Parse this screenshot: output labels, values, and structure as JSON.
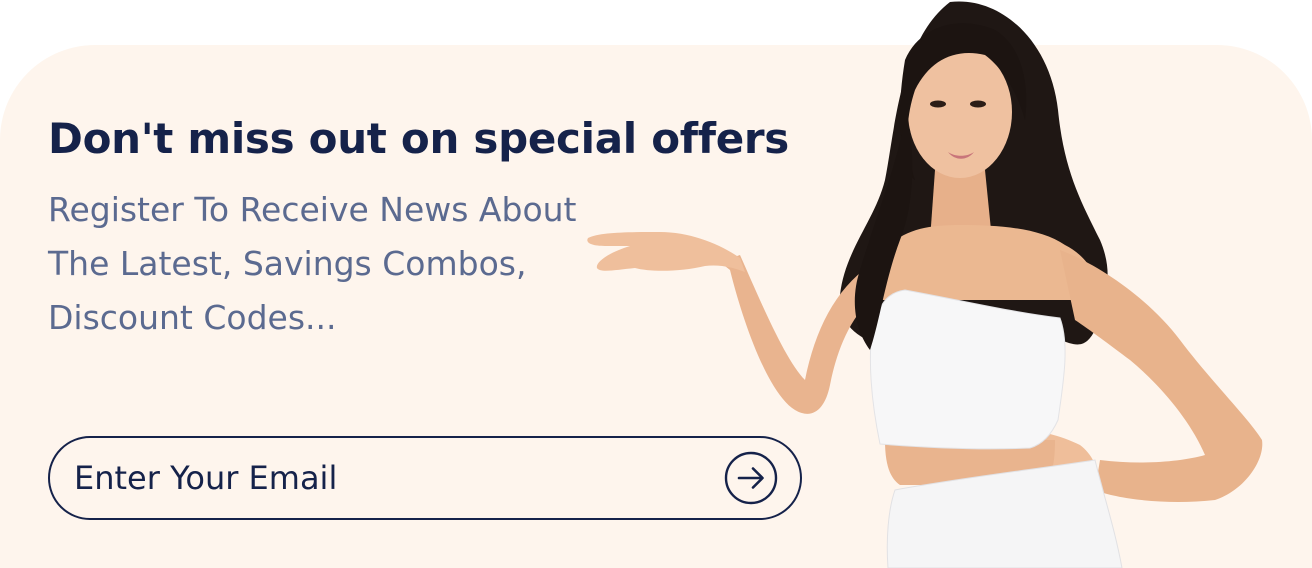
{
  "promo": {
    "headline": "Don't miss out on special offers",
    "subtext_lines": [
      "Register To Receive News About",
      "The Latest, Savings Combos,",
      "Discount Codes..."
    ]
  },
  "subscribe": {
    "email_placeholder": "Enter Your Email",
    "submit_icon": "arrow-right-circle-icon"
  },
  "colors": {
    "banner_bg": "#fef5ed",
    "heading": "#15224a",
    "subtext": "#5b6a90"
  }
}
